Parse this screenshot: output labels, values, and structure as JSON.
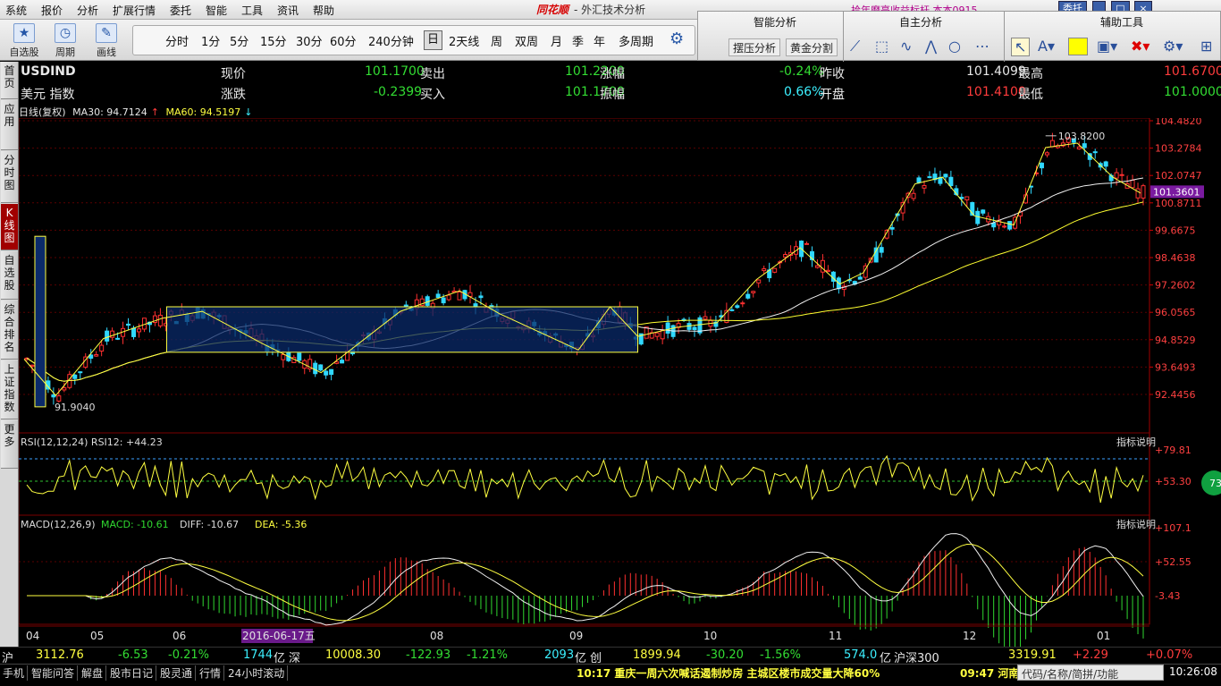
{
  "menubar": {
    "items": [
      "系统",
      "报价",
      "分析",
      "扩展行情",
      "委托",
      "智能",
      "工具",
      "资讯",
      "帮助"
    ],
    "title_logo": "同花顺",
    "title": "- 外汇技术分析",
    "marquee": "拾年磨亮收益标杆  本本0915",
    "trade_btn": "委托"
  },
  "toolbar": {
    "big_buttons": [
      {
        "label": "自选股",
        "icon": "star-icon"
      },
      {
        "label": "周期",
        "icon": "clock-icon"
      },
      {
        "label": "画线",
        "icon": "pen-icon"
      }
    ],
    "periods": [
      "分时",
      "1分",
      "5分",
      "15分",
      "30分",
      "60分",
      "240分钟",
      "日",
      "2天线",
      "周",
      "双周",
      "月",
      "季",
      "年",
      "多周期"
    ],
    "selected_period": "日"
  },
  "panel": {
    "smart_analysis": "智能分析",
    "self_analysis": "自主分析",
    "aux_tools": "辅助工具",
    "btn1": "摆压分析",
    "btn2": "黄金分割"
  },
  "rail": [
    "首页",
    "应用",
    "分时图",
    "K线图",
    "自选股",
    "综合排名",
    "上证指数",
    "更多"
  ],
  "quote": {
    "symbol": "USDIND",
    "name": "美元 指数",
    "now_label": "现价",
    "now": "101.1700",
    "sell_label": "卖出",
    "sell": "101.2200",
    "pct_label": "涨幅",
    "pct": "-0.24%",
    "prev_label": "昨收",
    "prev": "101.4099",
    "high_label": "最高",
    "high": "101.6700",
    "chg_label": "涨跌",
    "chg": "-0.2399",
    "buy_label": "买入",
    "buy": "101.1700",
    "amp_label": "振幅",
    "amp": "0.66%",
    "open_label": "开盘",
    "open": "101.4100",
    "low_label": "最低",
    "low": "101.0000"
  },
  "ma": {
    "kind": "日线(复权)",
    "ma30": "MA30: 94.7124",
    "ma60": "MA60: 94.5197"
  },
  "chart_data": {
    "type": "candlestick",
    "price_axis": [
      "104.4820",
      "103.2784",
      "102.0747",
      "100.8711",
      "99.6675",
      "98.4638",
      "97.2602",
      "96.0565",
      "94.8529",
      "93.6493",
      "92.4456"
    ],
    "current_price": "101.3601",
    "high_label": "103.8200",
    "low_label": "91.9040",
    "x_labels": [
      "04",
      "05",
      "06",
      "2016-06-17五",
      "08",
      "09",
      "10",
      "11",
      "12",
      "01"
    ],
    "rsi": {
      "label": "RSI(12,12,24) RSI12: +44.23",
      "axis": [
        "+79.81",
        "+53.30"
      ],
      "badge": "73"
    },
    "macd": {
      "label": "MACD(12,26,9)",
      "macd": "MACD: -10.61",
      "diff": "DIFF: -10.67",
      "dea": "DEA: -5.36",
      "axis": [
        "+107.1",
        "+52.55",
        "-3.43"
      ]
    },
    "indicator_help": "指标说明"
  },
  "indexbar": {
    "sh_label": "沪",
    "sh": "3112.76",
    "sh_chg": "-6.53",
    "sh_pct": "-0.21%",
    "sh_vol": "1744",
    "unit": "亿",
    "sz_label": "深",
    "sz": "10008.30",
    "sz_chg": "-122.93",
    "sz_pct": "-1.21%",
    "sz_vol": "2093",
    "cy_label": "创",
    "cy": "1899.94",
    "cy_chg": "-30.20",
    "cy_pct": "-1.56%",
    "cy_vol": "574.0",
    "hs_label": "沪深300",
    "hs": "3319.91",
    "hs_chg": "+2.29",
    "hs_pct": "+0.07%"
  },
  "statusbar": {
    "tabs": [
      "手机",
      "智能问答",
      "解盘",
      "股市日记",
      "股灵通",
      "行情",
      "24小时滚动"
    ],
    "news": "10:17 重庆一周六次喊话遏制炒房 主城区楼市成交量大降60%",
    "news2": "09:47 河南",
    "search_placeholder": "代码/名称/简拼/功能",
    "clock": "10:26:08"
  }
}
